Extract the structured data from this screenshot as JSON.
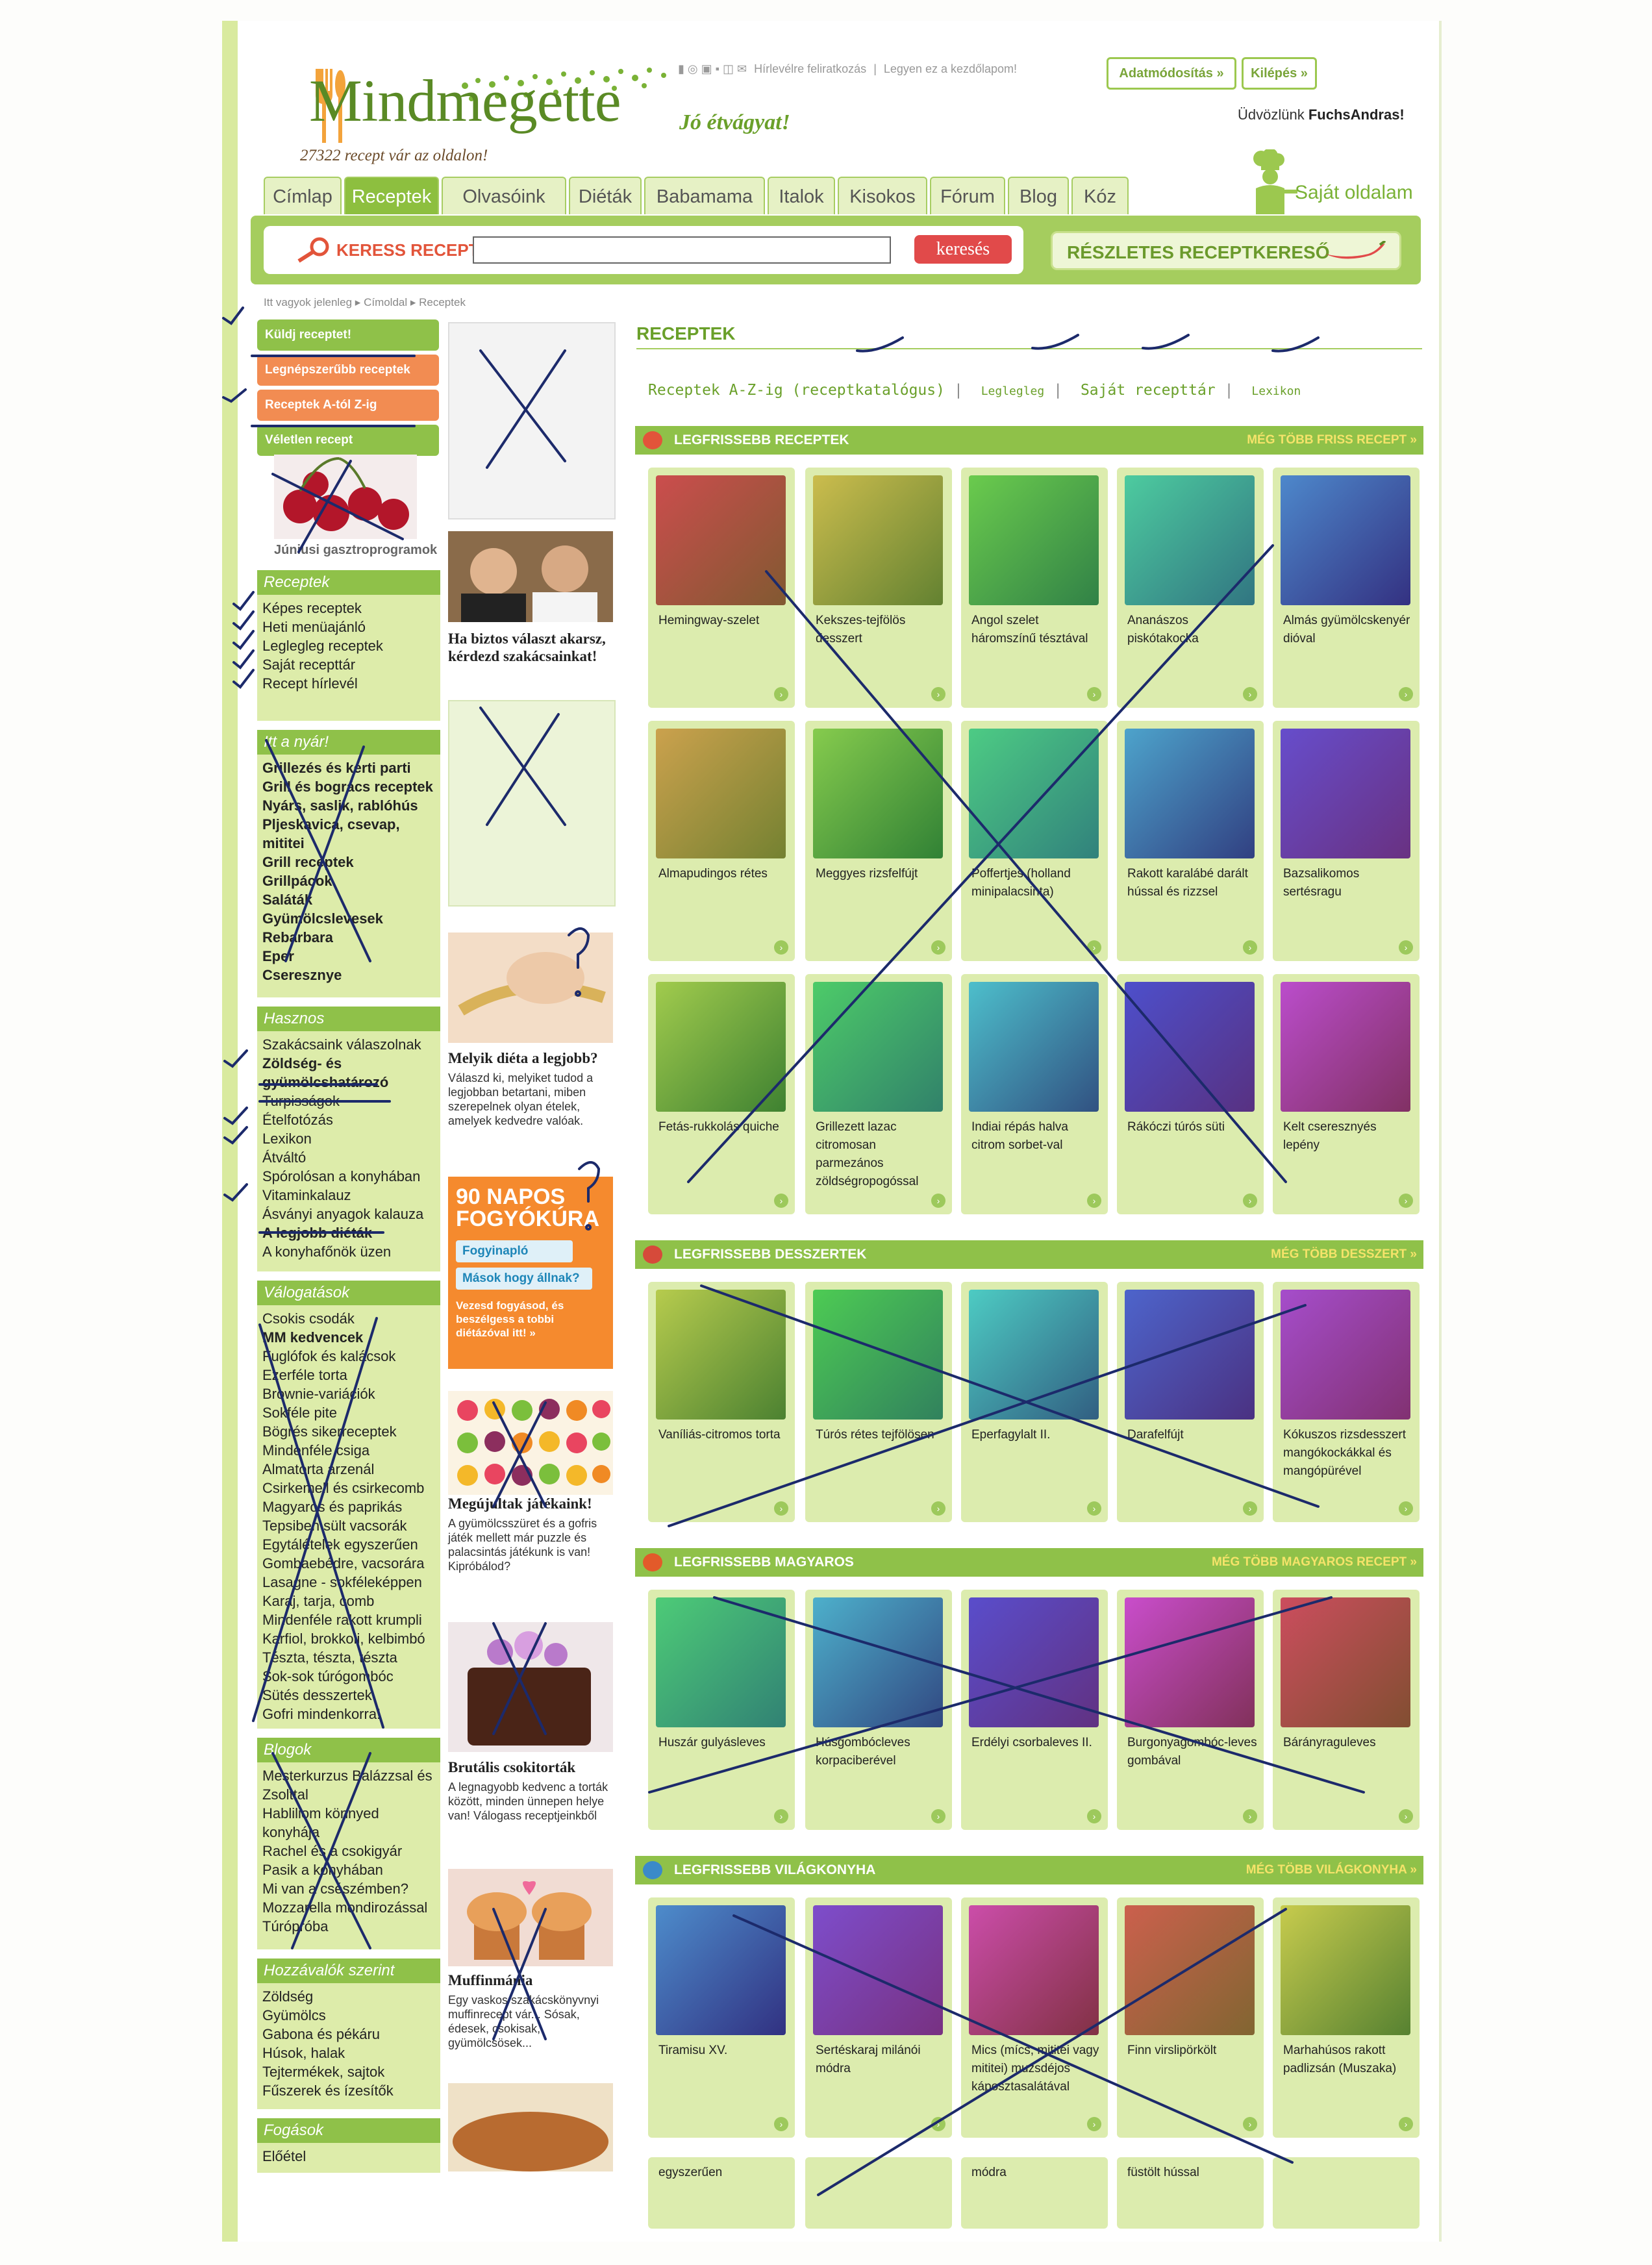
{
  "header": {
    "logo_text": "Mindmegette",
    "tagline": "Jó étvágyat!",
    "recipe_count": "27322 recept vár az oldalon!",
    "top_links": [
      "Hírlevélre feliratkozás",
      "Legyen ez a kezdőlapom!"
    ],
    "buttons": {
      "profile": "Adatmódosítás »",
      "logout": "Kilépés »"
    },
    "welcome_prefix": "Üdvözlünk ",
    "welcome_user": "FuchsAndras!",
    "own_page": "Saját oldalam"
  },
  "tabs": [
    "Címlap",
    "Receptek",
    "Olvasóink",
    "Diéták",
    "Babamama",
    "Italok",
    "Kisokos",
    "Fórum",
    "Blog",
    "Kóz"
  ],
  "search": {
    "label": "KERESS RECEPTET:",
    "button": "keresés",
    "advanced": "RÉSZLETES RECEPTKERESŐ"
  },
  "breadcrumb": "Itt vagyok jelenleg ▸ Címoldal ▸ Receptek",
  "left_buttons": [
    "Küldj receptet!",
    "Legnépszerűbb receptek",
    "Receptek A-tól Z-ig",
    "Véletlen recept"
  ],
  "banner_caption": "Júniusi gasztroprogramok",
  "sections": [
    {
      "title": "Receptek",
      "bold": false,
      "items": [
        "Képes receptek",
        "Heti menüajánló",
        "Leglegleg receptek",
        "Saját recepttár",
        "Recept hírlevél"
      ]
    },
    {
      "title": "Itt a nyár!",
      "bold": true,
      "items": [
        "Grillezés és kerti parti",
        "Grill és bogrács receptek",
        "Nyárs, saslik, rablóhús",
        "Pljeskavica, csevap, mititei",
        "Grill receptek",
        "Grillpácok",
        "Saláták",
        "Gyümölcslevesek",
        "Rebarbara",
        "Eper",
        "Cseresznye"
      ]
    },
    {
      "title": "Hasznos",
      "bold": false,
      "items": [
        "Szakácsaink válaszolnak",
        "Zöldség- és gyümölcshatározó",
        "Turpisságok",
        "Ételfotózás",
        "Lexikon",
        "Átváltó",
        "Spórolósan a konyhában",
        "Vitaminkalauz",
        "Ásványi anyagok kalauza",
        "A legjobb diéták",
        "A konyhafőnök üzen"
      ]
    },
    {
      "title": "Válogatások",
      "bold": false,
      "items": [
        "Csokis csodák",
        "MM kedvencek",
        "Fuglófok és kalácsok",
        "Ezerféle torta",
        "Brownie-variációk",
        "Sokféle pite",
        "Bögrés sikerreceptek",
        "Mindenféle csiga",
        "Almatorta arzenál",
        "Csirkemell és csirkecomb",
        "Magyaros és paprikás",
        "Tepsiben sült vacsorák",
        "Egytálételek egyszerűen",
        "Gombaebédre, vacsorára",
        "Lasagne - sokféleképpen",
        "Karaj, tarja, comb",
        "Mindenféle rakott krumpli",
        "Karfiol, brokkoli, kelbimbó",
        "Tészta, tészta, tészta",
        "Sok-sok túrógombóc",
        "Sütés desszertek",
        "Gofri mindenkorra!"
      ]
    },
    {
      "title": "Blogok",
      "bold": false,
      "items": [
        "Mesterkurzus Balázzsal és Zsolttal",
        "Habliliom könnyed konyhája",
        "Rachel és a csokigyár",
        "Pasik a konyhában",
        "Mi van a csészémben?",
        "Mozzarella mondirozással",
        "Túrópróba"
      ]
    },
    {
      "title": "Hozzávalók szerint",
      "bold": false,
      "items": [
        "Zöldség",
        "Gyümölcs",
        "Gabona és pékáru",
        "Húsok, halak",
        "Tejtermékek, sajtok",
        "Fűszerek és ízesítők"
      ]
    },
    {
      "title": "Fogások",
      "bold": false,
      "items": [
        "Előétel"
      ]
    }
  ],
  "promos": [
    {
      "title": "Ha biztos választ akarsz, kérdezd szakácsainkat!",
      "text": ""
    },
    {
      "title": "Melyik diéta a legjobb?",
      "text": "Válaszd ki, melyiket tudod a legjobban betartani, miben szerepelnek olyan ételek, amelyek kedvedre valóak."
    },
    {
      "title": "",
      "text": "Vezesd fogyásod, és beszélgess a tobbi diétázóval itt! »",
      "ad_head": "90 NAPOS FOGYÓKÚRA",
      "ad_btn1": "Fogyinapló",
      "ad_btn2": "Mások hogy állnak?"
    },
    {
      "title": "Megújultak játékaink!",
      "text": "A gyümölcsszüret és a gofris játék mellett már puzzle és palacsintás játékunk is van! Kipróbálod?"
    },
    {
      "title": "Brutális csokitorták",
      "text": "A legnagyobb kedvenc a torták között, minden ünnepen helye van! Válogass receptjeinkből"
    },
    {
      "title": "Muffinmánia",
      "text": "Egy vaskos szakácskönyvnyi muffinrecept vár... Sósak, édesek, csokisak, gyümölcsösek..."
    }
  ],
  "main": {
    "title": "RECEPTEK",
    "sublinks": [
      "Receptek A-Z-ig (receptkatalógus)",
      "Leglegleg",
      "Saját recepttár",
      "Lexikon"
    ]
  },
  "blocks": [
    {
      "title": "LEGFRISSEBB RECEPTEK",
      "more": "MÉG TÖBB FRISS RECEPT »",
      "rows": [
        [
          "Hemingway-szelet",
          "Kekszes-tejfölös desszert",
          "Angol szelet háromszínű tésztával",
          "Ananászos piskótakocka",
          "Almás gyümölcskenyér dióval"
        ],
        [
          "Almapudingos rétes",
          "Meggyes rizsfelfújt",
          "Poffertjes (holland minipalacsinta)",
          "Rakott karalábé darált hússal és rizzsel",
          "Bazsalikomos sertésragu"
        ],
        [
          "Fetás-rukkolás quiche",
          "Grillezett lazac citromosan parmezános zöldségropogóssal",
          "Indiai répás halva citrom sorbet-val",
          "Rákóczi túrós süti",
          "Kelt cseresznyés lepény"
        ]
      ]
    },
    {
      "title": "LEGFRISSEBB DESSZERTEK",
      "more": "MÉG TÖBB DESSZERT »",
      "rows": [
        [
          "Vaníliás-citromos torta",
          "Túrós rétes tejfölösen",
          "Eperfagylalt II.",
          "Darafelfújt",
          "Kókuszos rizsdesszert mangókockákkal és mangópürével"
        ]
      ]
    },
    {
      "title": "LEGFRISSEBB MAGYAROS",
      "more": "MÉG TÖBB MAGYAROS RECEPT »",
      "rows": [
        [
          "Huszár gulyásleves",
          "Húsgombócleves korpaciberével",
          "Erdélyi csorbaleves II.",
          "Burgonyagombóc-leves gombával",
          "Bárányraguleves"
        ]
      ]
    },
    {
      "title": "LEGFRISSEBB VILÁGKONYHA",
      "more": "MÉG TÖBB VILÁGKONYHA »",
      "rows": [
        [
          "Tiramisu XV.",
          "Sertéskaraj milánói módra",
          "Mics (mícs, mititei vagy mititei) muzsdéjos káposztasalátával",
          "Finn virslipörkölt",
          "Marhahúsos rakott padlizsán (Muszaka)"
        ]
      ]
    }
  ],
  "bottom_row": [
    "egyszerűen",
    "",
    "módra",
    "füstölt hússal",
    ""
  ],
  "colors": {
    "brand_green": "#8fc149",
    "orange": "#f28c52",
    "red": "#e14a4a",
    "pen": "#1c2a6b"
  }
}
